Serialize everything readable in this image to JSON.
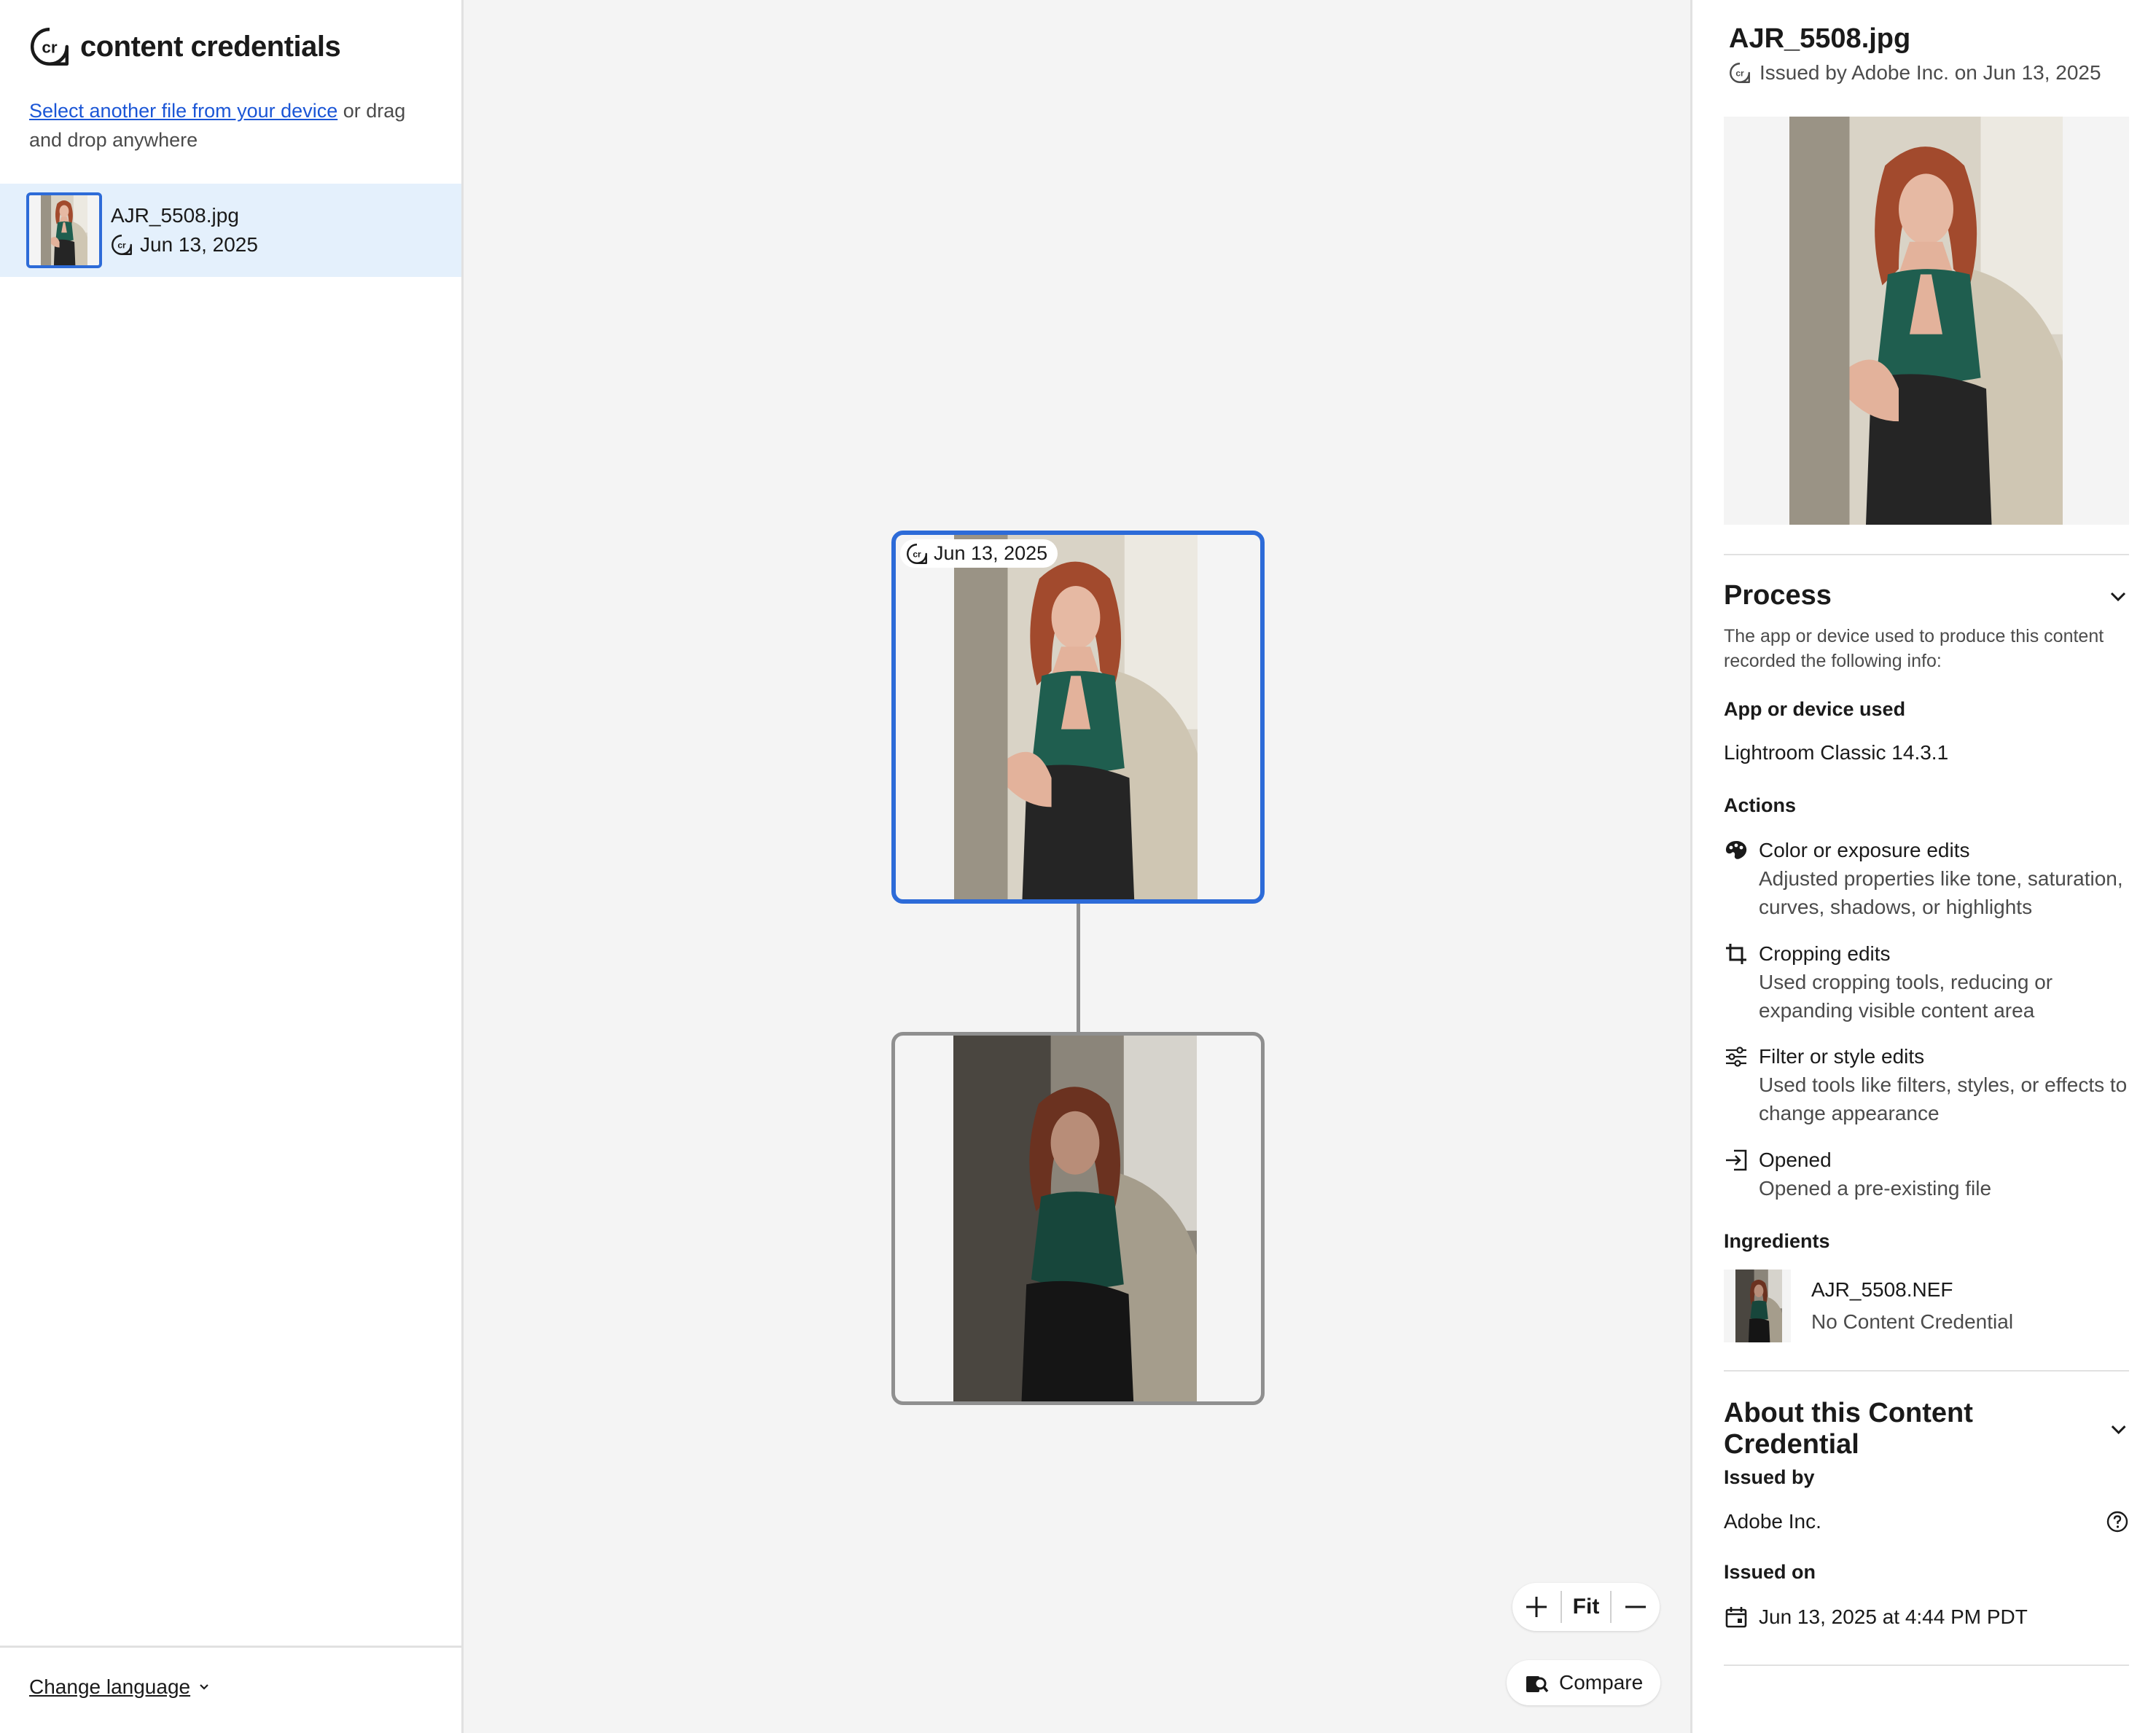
{
  "brand": {
    "name": "content credentials"
  },
  "sidebar": {
    "select_link": "Select another file from your device",
    "select_rest": " or drag and drop anywhere",
    "file": {
      "name": "AJR_5508.jpg",
      "date": "Jun 13, 2025"
    },
    "change_language": "Change language"
  },
  "canvas": {
    "top_node_date": "Jun 13, 2025",
    "zoom_in": "+",
    "zoom_fit": "Fit",
    "zoom_out": "—",
    "compare": "Compare"
  },
  "panel": {
    "title": "AJR_5508.jpg",
    "issued_line": "Issued by Adobe Inc. on Jun 13, 2025",
    "process": {
      "heading": "Process",
      "description": "The app or device used to produce this content recorded the following info:",
      "app_label": "App or device used",
      "app_value": "Lightroom Classic 14.3.1",
      "actions_label": "Actions",
      "actions": [
        {
          "icon": "palette-icon",
          "title": "Color or exposure edits",
          "desc": "Adjusted properties like tone, saturation, curves, shadows, or highlights"
        },
        {
          "icon": "crop-icon",
          "title": "Cropping edits",
          "desc": "Used cropping tools, reducing or expanding visible content area"
        },
        {
          "icon": "sliders-icon",
          "title": "Filter or style edits",
          "desc": "Used tools like filters, styles, or effects to change appearance"
        },
        {
          "icon": "open-file-icon",
          "title": "Opened",
          "desc": "Opened a pre-existing file"
        }
      ],
      "ingredients_label": "Ingredients",
      "ingredient": {
        "name": "AJR_5508.NEF",
        "status": "No Content Credential"
      }
    },
    "about": {
      "heading": "About this Content Credential",
      "issued_by_label": "Issued by",
      "issued_by_value": "Adobe Inc.",
      "issued_on_label": "Issued on",
      "issued_on_value": "Jun 13, 2025 at 4:44 PM PDT"
    }
  },
  "colors": {
    "accent": "#2d6bd8",
    "link": "#1b56d6",
    "selected_row": "#e4f0fc",
    "canvas_bg": "#f4f4f4",
    "dress": "#1f5e4f",
    "hair": "#a24a2d"
  }
}
